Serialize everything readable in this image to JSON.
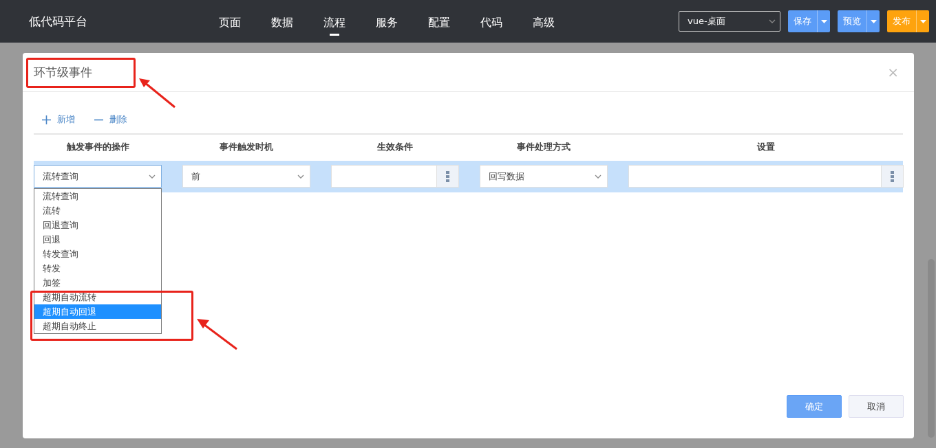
{
  "top_bar": {
    "logo": "低代码平台",
    "nav": [
      {
        "label": "页面",
        "selected": false
      },
      {
        "label": "数据",
        "selected": false
      },
      {
        "label": "流程",
        "selected": true
      },
      {
        "label": "服务",
        "selected": false
      },
      {
        "label": "配置",
        "selected": false
      },
      {
        "label": "代码",
        "selected": false
      },
      {
        "label": "高级",
        "selected": false
      }
    ],
    "environment_select": {
      "value": "vue-桌面"
    },
    "buttons": [
      {
        "label": "保存",
        "kind": "primary"
      },
      {
        "label": "预览",
        "kind": "primary"
      },
      {
        "label": "发布",
        "kind": "warning"
      }
    ]
  },
  "dialog": {
    "title": "环节级事件",
    "close": "×",
    "toolbar": [
      {
        "label": "新增",
        "kind": "plus"
      },
      {
        "label": "删除",
        "kind": "minus"
      }
    ],
    "table": {
      "columns": [
        "触发事件的操作",
        "事件触发时机",
        "生效条件",
        "事件处理方式",
        "设置"
      ],
      "rows": [
        {
          "selected": true,
          "cells": [
            {
              "kind": "select",
              "value": "流转查询",
              "open": true
            },
            {
              "kind": "select",
              "value": "前",
              "open": false
            },
            {
              "kind": "picker"
            },
            {
              "kind": "select",
              "value": "回写数据",
              "open": false
            },
            {
              "kind": "picker"
            }
          ]
        }
      ]
    },
    "dropdown_options": [
      {
        "label": "流转查询",
        "selected": false
      },
      {
        "label": "流转",
        "selected": false
      },
      {
        "label": "回退查询",
        "selected": false
      },
      {
        "label": "回退",
        "selected": false
      },
      {
        "label": "转发查询",
        "selected": false
      },
      {
        "label": "转发",
        "selected": false
      },
      {
        "label": "加签",
        "selected": false
      },
      {
        "label": "超期自动流转",
        "selected": false
      },
      {
        "label": "超期自动回退",
        "selected": true
      },
      {
        "label": "超期自动终止",
        "selected": false
      }
    ],
    "footer_buttons": [
      {
        "label": "确定",
        "kind": "primary"
      },
      {
        "label": "取消",
        "kind": "default"
      }
    ]
  }
}
